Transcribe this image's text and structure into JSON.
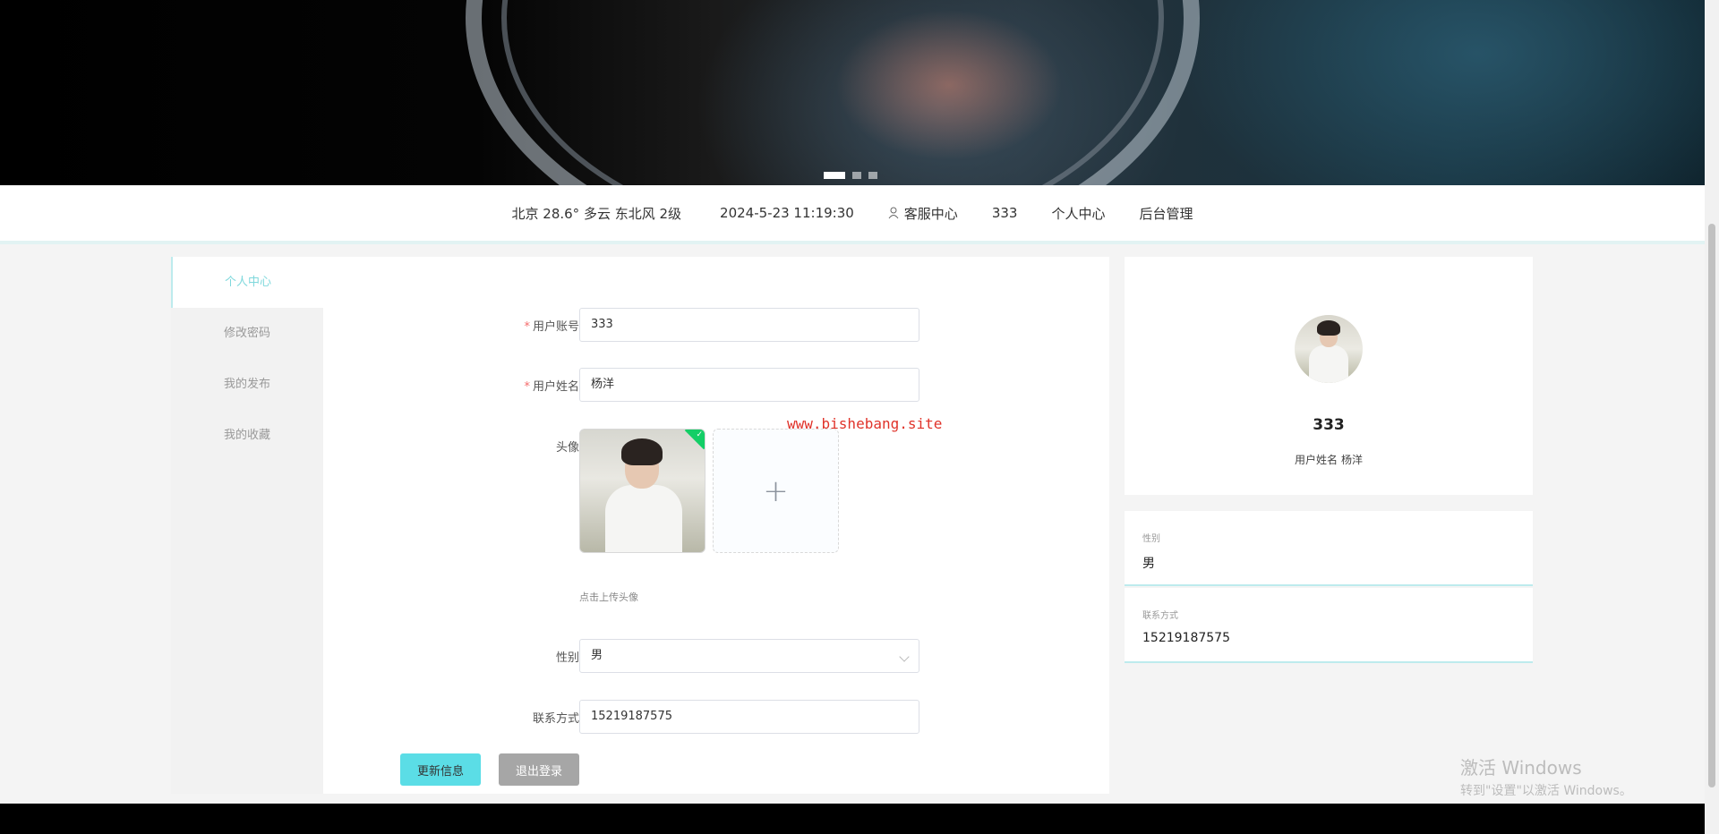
{
  "banner": {
    "carousel_dots": 3,
    "active_dot": 0
  },
  "topbar": {
    "weather": "北京  28.6°  多云  东北风  2级",
    "datetime": "2024-5-23 11:19:30",
    "customer_service": "客服中心",
    "username": "333",
    "personal_center": "个人中心",
    "admin": "后台管理"
  },
  "side_menu": {
    "items": [
      {
        "label": "个人中心",
        "active": true
      },
      {
        "label": "修改密码",
        "active": false
      },
      {
        "label": "我的发布",
        "active": false
      },
      {
        "label": "我的收藏",
        "active": false
      }
    ]
  },
  "form": {
    "account_label": "用户账号",
    "account_value": "333",
    "name_label": "用户姓名",
    "name_value": "杨洋",
    "avatar_label": "头像",
    "upload_tip": "点击上传头像",
    "gender_label": "性别",
    "gender_value": "男",
    "contact_label": "联系方式",
    "contact_value": "15219187575",
    "update_button": "更新信息",
    "logout_button": "退出登录"
  },
  "watermark_url": "www.bishebang.site",
  "profile": {
    "username": "333",
    "fullname_label": "用户姓名",
    "fullname_value": "杨洋",
    "gender_title": "性别",
    "gender_value": "男",
    "contact_title": "联系方式",
    "contact_value": "15219187575"
  },
  "windows_activation": {
    "title": "激活 Windows",
    "subtitle": "转到\"设置\"以激活 Windows。"
  },
  "colors": {
    "accent": "#5bdde6",
    "active_menu_text": "#7fd8dc",
    "logout_button": "#a6a6a6",
    "watermark_red": "#e0332a"
  }
}
